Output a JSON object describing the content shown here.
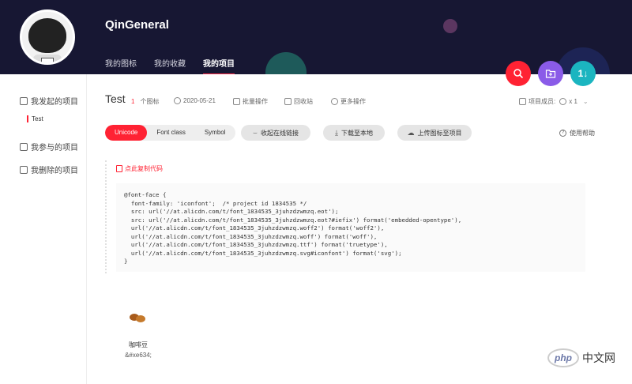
{
  "header": {
    "username": "QinGeneral",
    "tabs": [
      {
        "label": "我的图标",
        "active": false
      },
      {
        "label": "我的收藏",
        "active": false
      },
      {
        "label": "我的项目",
        "active": true
      }
    ]
  },
  "fabs": {
    "search_icon": "⌕",
    "folder_icon": "⊞",
    "sort_icon": "1↓"
  },
  "sidebar": {
    "items": [
      {
        "label": "我发起的项目"
      },
      {
        "label": "我参与的项目"
      },
      {
        "label": "我删除的项目"
      }
    ],
    "sub_item": "Test"
  },
  "project": {
    "title": "Test",
    "icon_count": "1",
    "icon_count_unit": "个图标",
    "date": "2020-05-21",
    "batch": "批量操作",
    "recycle": "回收站",
    "more": "更多操作",
    "members_label": "项目成员:",
    "members_count": "x 1"
  },
  "format_tabs": [
    {
      "label": "Unicode",
      "active": true
    },
    {
      "label": "Font class",
      "active": false
    },
    {
      "label": "Symbol",
      "active": false
    }
  ],
  "actions": {
    "collapse_link": "收起在线链接",
    "download": "下载至本地",
    "upload": "上传图标至项目",
    "help": "使用帮助"
  },
  "copy_label": "点此复制代码",
  "code": "@font-face {\n  font-family: 'iconfont';  /* project id 1834535 */\n  src: url('//at.alicdn.com/t/font_1834535_3juhzdzwmzq.eot');\n  src: url('//at.alicdn.com/t/font_1834535_3juhzdzwmzq.eot?#iefix') format('embedded-opentype'),\n  url('//at.alicdn.com/t/font_1834535_3juhzdzwmzq.woff2') format('woff2'),\n  url('//at.alicdn.com/t/font_1834535_3juhzdzwmzq.woff') format('woff'),\n  url('//at.alicdn.com/t/font_1834535_3juhzdzwmzq.ttf') format('truetype'),\n  url('//at.alicdn.com/t/font_1834535_3juhzdzwmzq.svg#iconfont') format('svg');\n}",
  "icon_item": {
    "name": "咖啡豆",
    "code": "&#xe634;"
  },
  "watermark": {
    "logo": "php",
    "text": "中文网"
  },
  "colors": {
    "accent": "#ff2233",
    "header_bg": "#171733",
    "fab_purple": "#8a5be8",
    "fab_teal": "#1bb5c0"
  }
}
